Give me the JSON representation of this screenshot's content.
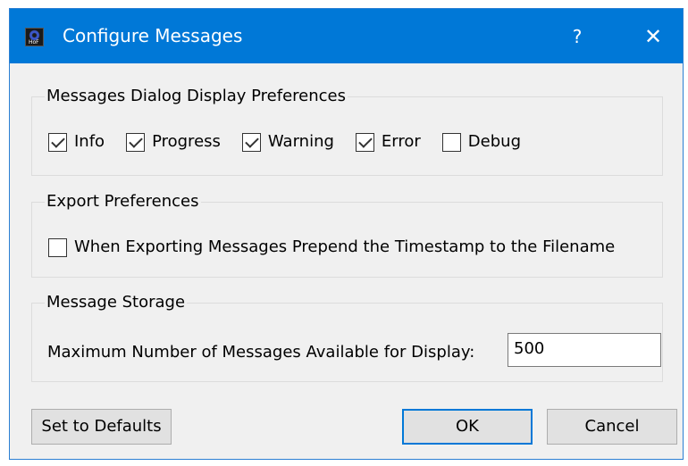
{
  "window": {
    "title": "Configure Messages",
    "help_glyph": "?",
    "close_glyph": "✕",
    "icon_text": "HoF"
  },
  "display_prefs": {
    "title": "Messages Dialog Display Preferences",
    "items": [
      {
        "label": "Info",
        "checked": true
      },
      {
        "label": "Progress",
        "checked": true
      },
      {
        "label": "Warning",
        "checked": true
      },
      {
        "label": "Error",
        "checked": true
      },
      {
        "label": "Debug",
        "checked": false
      }
    ]
  },
  "export_prefs": {
    "title": "Export Preferences",
    "timestamp_label": "When Exporting Messages Prepend the Timestamp to the Filename",
    "timestamp_checked": false
  },
  "storage": {
    "title": "Message Storage",
    "max_label": "Maximum Number of Messages Available for Display:",
    "max_value": "500"
  },
  "buttons": {
    "defaults": "Set to Defaults",
    "ok": "OK",
    "cancel": "Cancel"
  },
  "colors": {
    "titlebar": "#0078d7",
    "dialog_bg": "#f0f0f0",
    "button_bg": "#e1e1e1",
    "default_button_border": "#0078d7"
  }
}
